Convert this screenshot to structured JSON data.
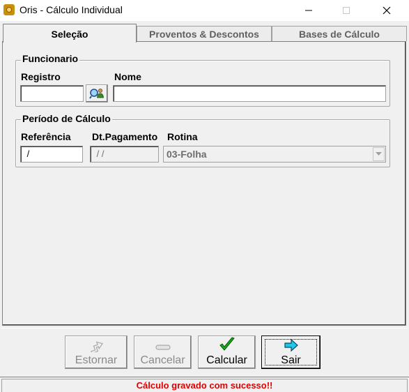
{
  "window": {
    "title": "Oris - Cálculo Individual",
    "accent": "#c8900a"
  },
  "tabs": [
    {
      "label": "Seleção",
      "active": true
    },
    {
      "label": "Proventos & Descontos",
      "active": false
    },
    {
      "label": "Bases de Cálculo",
      "active": false
    }
  ],
  "funcionario": {
    "group_title": "Funcionario",
    "registro_label": "Registro",
    "registro_value": "",
    "nome_label": "Nome",
    "nome_value": "",
    "lookup_icon": "search-person-icon"
  },
  "periodo": {
    "group_title": "Período de Cálculo",
    "referencia_label": "Referência",
    "referencia_value": " /",
    "dt_pagamento_label": "Dt.Pagamento",
    "dt_pagamento_value": " / /",
    "rotina_label": "Rotina",
    "rotina_value": "03-Folha"
  },
  "buttons": {
    "estornar": {
      "label": "Estornar",
      "enabled": false,
      "icon": "undo-arrow-icon"
    },
    "cancelar": {
      "label": "Cancelar",
      "enabled": false,
      "icon": "cancel-bar-icon"
    },
    "calcular": {
      "label": "Calcular",
      "enabled": true,
      "icon": "green-check-icon"
    },
    "sair": {
      "label": "Sair",
      "enabled": true,
      "icon": "cyan-arrow-right-icon"
    }
  },
  "status": {
    "message": "Cálculo gravado com sucesso!!",
    "color": "#e00000"
  }
}
